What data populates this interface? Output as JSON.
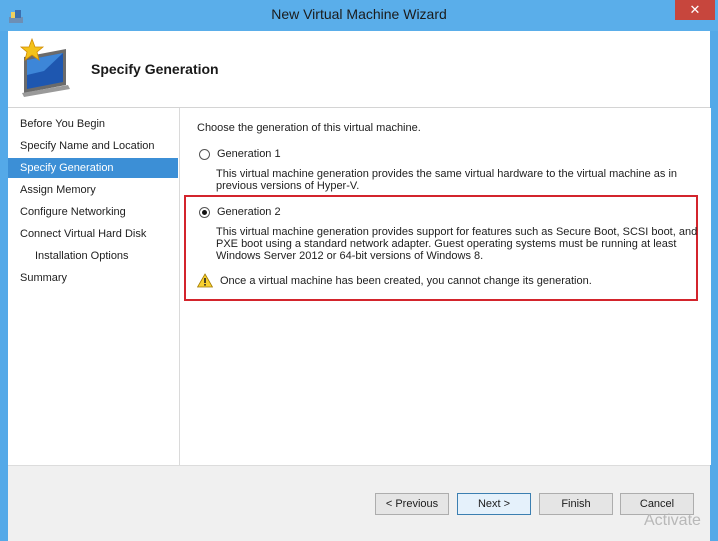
{
  "window": {
    "title": "New Virtual Machine Wizard",
    "close_icon": "close-icon",
    "accent_color": "#5aaeea"
  },
  "header": {
    "title": "Specify Generation",
    "icon": "wizard-monitor-icon"
  },
  "steps": [
    {
      "label": "Before You Begin",
      "active": false,
      "indent": false
    },
    {
      "label": "Specify Name and Location",
      "active": false,
      "indent": false
    },
    {
      "label": "Specify Generation",
      "active": true,
      "indent": false
    },
    {
      "label": "Assign Memory",
      "active": false,
      "indent": false
    },
    {
      "label": "Configure Networking",
      "active": false,
      "indent": false
    },
    {
      "label": "Connect Virtual Hard Disk",
      "active": false,
      "indent": false
    },
    {
      "label": "Installation Options",
      "active": false,
      "indent": true
    },
    {
      "label": "Summary",
      "active": false,
      "indent": false
    }
  ],
  "content": {
    "prompt": "Choose the generation of this virtual machine.",
    "gen1": {
      "label": "Generation 1",
      "selected": false,
      "desc_line1": "This virtual machine generation provides the same virtual hardware to the virtual machine as in",
      "desc_line2": "previous versions of Hyper-V."
    },
    "gen2": {
      "label": "Generation 2",
      "selected": true,
      "desc_line1": "This virtual machine generation provides support for features such as Secure Boot, SCSI boot, and",
      "desc_line2": "PXE boot using a standard network adapter. Guest operating systems must be running at least",
      "desc_line3": "Windows Server 2012 or 64-bit versions of Windows 8."
    },
    "warning": "Once a virtual machine has been created, you cannot change its generation.",
    "warning_icon": "warning-icon",
    "highlight_color": "#d3242c"
  },
  "buttons": {
    "previous": "< Previous",
    "next": "Next >",
    "finish": "Finish",
    "cancel": "Cancel"
  },
  "watermark": "Activate"
}
